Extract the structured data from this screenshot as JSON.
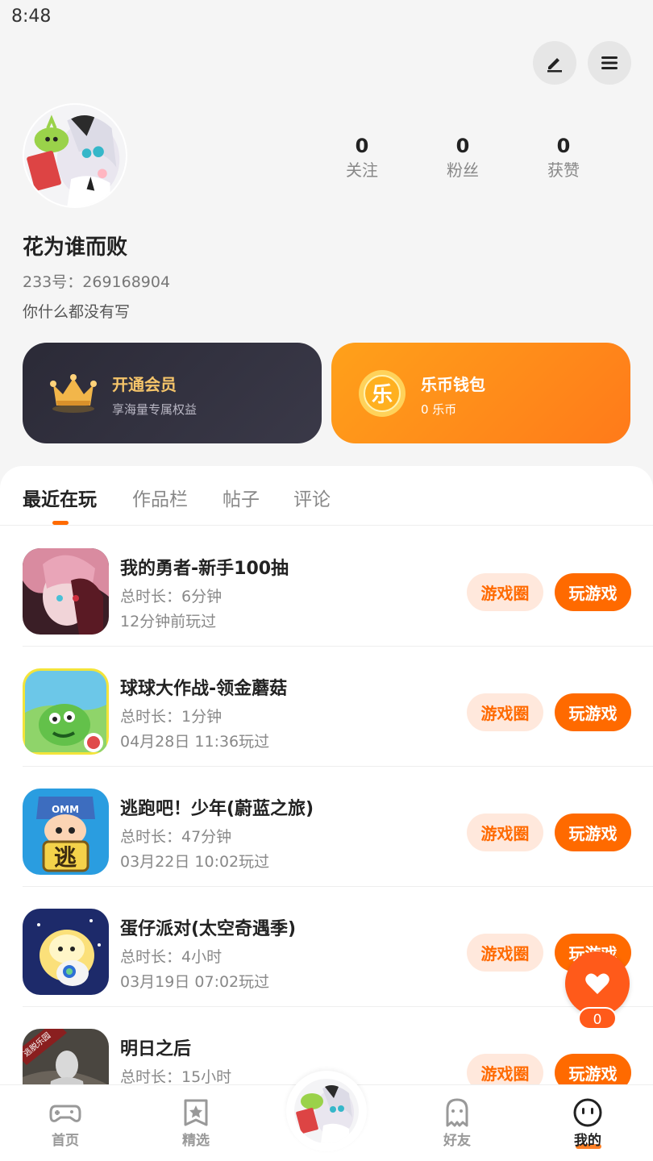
{
  "status_bar": {
    "time": "8:48"
  },
  "header": {
    "edit_icon": "pencil-icon",
    "menu_icon": "menu-icon"
  },
  "profile": {
    "username": "花为谁而败",
    "user_id": "233号：269168904",
    "bio": "你什么都没有写",
    "stats": [
      {
        "value": "0",
        "label": "关注"
      },
      {
        "value": "0",
        "label": "粉丝"
      },
      {
        "value": "0",
        "label": "获赞"
      }
    ]
  },
  "cards": {
    "vip": {
      "title": "开通会员",
      "subtitle": "享海量专属权益",
      "icon": "crown-icon"
    },
    "wallet": {
      "title": "乐币钱包",
      "subtitle": "0 乐币",
      "icon": "coin-icon",
      "coin_char": "乐"
    }
  },
  "tabs": [
    {
      "label": "最近在玩",
      "active": true
    },
    {
      "label": "作品栏",
      "active": false
    },
    {
      "label": "帖子",
      "active": false
    },
    {
      "label": "评论",
      "active": false
    }
  ],
  "games": [
    {
      "title": "我的勇者-新手100抽",
      "duration": "总时长：6分钟",
      "last_played": "12分钟前玩过",
      "circle_label": "游戏圈",
      "play_label": "玩游戏"
    },
    {
      "title": "球球大作战-领金蘑菇",
      "duration": "总时长：1分钟",
      "last_played": "04月28日 11:36玩过",
      "circle_label": "游戏圈",
      "play_label": "玩游戏"
    },
    {
      "title": "逃跑吧！少年(蔚蓝之旅)",
      "duration": "总时长：47分钟",
      "last_played": "03月22日 10:02玩过",
      "circle_label": "游戏圈",
      "play_label": "玩游戏",
      "icon_char": "逃",
      "icon_badge": "OMM"
    },
    {
      "title": "蛋仔派对(太空奇遇季)",
      "duration": "总时长：4小时",
      "last_played": "03月19日 07:02玩过",
      "circle_label": "游戏圈",
      "play_label": "玩游戏"
    },
    {
      "title": "明日之后",
      "duration": "总时长：15小时",
      "last_played": "",
      "circle_label": "游戏圈",
      "play_label": "玩游戏",
      "icon_ribbon": "逃脱乐园"
    }
  ],
  "fab": {
    "icon": "heart-icon",
    "count": "0"
  },
  "bottom_nav": [
    {
      "label": "首页",
      "icon": "gamepad-icon",
      "active": false
    },
    {
      "label": "精选",
      "icon": "star-bookmark-icon",
      "active": false
    },
    {
      "label": "好友",
      "icon": "ghost-icon",
      "active": false
    },
    {
      "label": "我的",
      "icon": "face-icon",
      "active": true
    }
  ],
  "colors": {
    "accent": "#ff6a00",
    "vip_gold": "#f6c56a",
    "vip_bg": "#2b2a37",
    "wallet_bg": "#ff9014"
  }
}
